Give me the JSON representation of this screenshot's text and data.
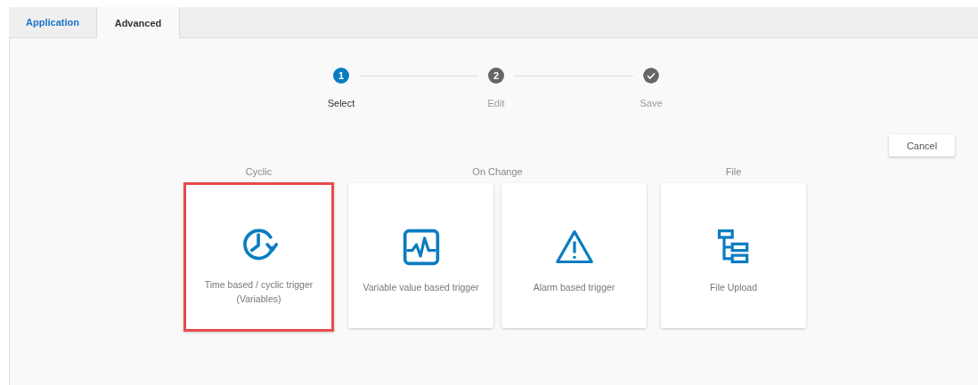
{
  "tabs": [
    {
      "label": "Application",
      "selected": false
    },
    {
      "label": "Advanced",
      "selected": true
    }
  ],
  "steps": [
    {
      "kind": "number",
      "number": "1",
      "label": "Select",
      "selected": true
    },
    {
      "kind": "number",
      "number": "2",
      "label": "Edit",
      "selected": false
    },
    {
      "kind": "check",
      "label": "Save",
      "selected": false
    }
  ],
  "cancel_button": "Cancel",
  "groups": [
    {
      "title": "Cyclic",
      "cards": [
        {
          "kind": "clock",
          "label": "Time based / cyclic trigger\n(Variables)",
          "selected": true
        }
      ]
    },
    {
      "title": "On Change",
      "cards": [
        {
          "kind": "pulse",
          "label": "Variable value based trigger",
          "selected": false
        },
        {
          "kind": "warning",
          "label": "Alarm based trigger",
          "selected": false
        }
      ]
    },
    {
      "title": "File",
      "cards": [
        {
          "kind": "tree",
          "label": "File Upload",
          "selected": false
        }
      ]
    }
  ]
}
